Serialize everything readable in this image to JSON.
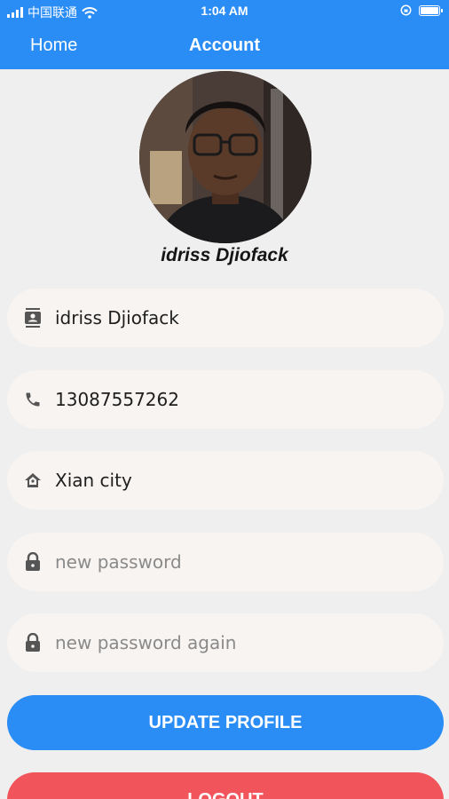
{
  "status_bar": {
    "carrier": "中国联通",
    "time": "1:04 AM"
  },
  "nav": {
    "back_label": "Home",
    "title": "Account"
  },
  "profile": {
    "display_name": "idriss Djiofack"
  },
  "form": {
    "name": {
      "value": "idriss Djiofack",
      "icon": "contact-card-icon"
    },
    "phone": {
      "value": "13087557262",
      "icon": "phone-icon"
    },
    "address": {
      "value": "Xian city",
      "icon": "home-icon"
    },
    "new_password": {
      "placeholder": "new password",
      "icon": "lock-icon"
    },
    "new_password_again": {
      "placeholder": "new password again",
      "icon": "lock-icon"
    }
  },
  "buttons": {
    "update_label": "UPDATE PROFILE",
    "logout_label": "LOGOUT"
  },
  "colors": {
    "primary": "#2a8cf5",
    "danger": "#f2545b",
    "field_bg": "#f7f4f2",
    "page_bg": "#efefef"
  }
}
